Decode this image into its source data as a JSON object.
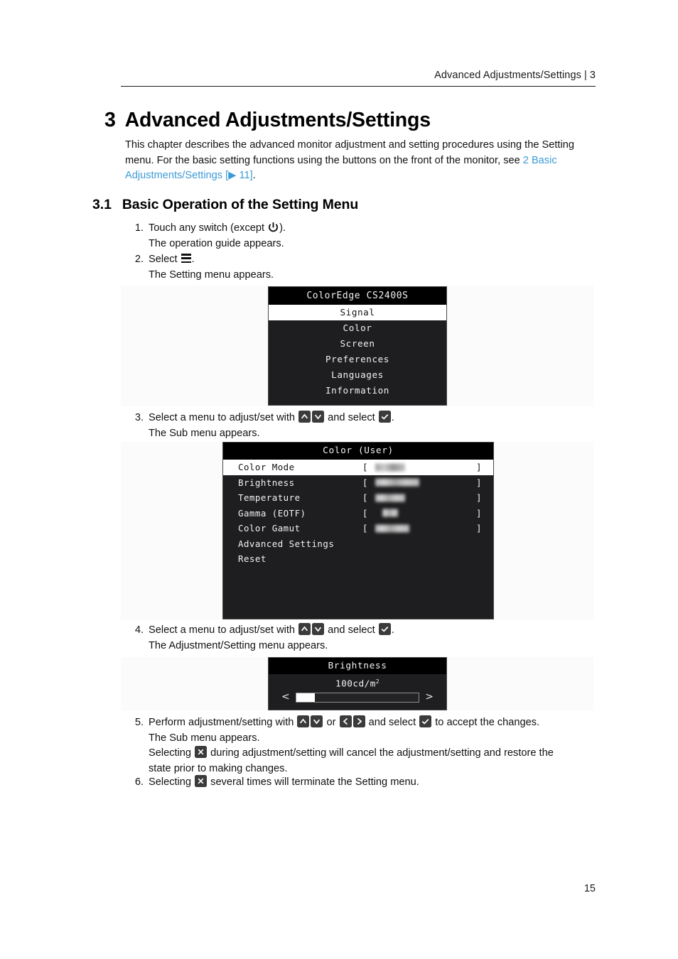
{
  "header": {
    "title": "Advanced Adjustments/Settings",
    "separator": "|",
    "chapter_number": "3"
  },
  "chapter": {
    "number": "3",
    "title": "Advanced Adjustments/Settings"
  },
  "intro": {
    "line1": "This chapter describes the advanced monitor adjustment and setting procedures using the",
    "line2": "Setting menu. For the basic setting functions using the buttons on the front of the monitor,",
    "line3_prefix": "see ",
    "link_text": "2 Basic Adjustments/Settings [",
    "link_arrow": "▶",
    "link_page": " 11]",
    "line3_suffix": "."
  },
  "section": {
    "number": "3.1",
    "title": "Basic Operation of the Setting Menu"
  },
  "steps": {
    "s1": {
      "marker": "1.",
      "text_a": "Touch any switch (except ",
      "text_b": ").",
      "sub": "The operation guide appears."
    },
    "s2": {
      "marker": "2.",
      "text_a": "Select ",
      "text_b": ".",
      "sub": "The Setting menu appears."
    },
    "s3": {
      "marker": "3.",
      "text_a": "Select a menu to adjust/set with ",
      "text_b": " and select ",
      "text_c": ".",
      "sub": "The Sub menu appears."
    },
    "s4": {
      "marker": "4.",
      "text_a": "Select a menu to adjust/set with ",
      "text_b": " and select ",
      "text_c": ".",
      "sub": "The Adjustment/Setting menu appears."
    },
    "s5": {
      "marker": "5.",
      "text_a": "Perform adjustment/setting with ",
      "text_b": " or ",
      "text_c": " and select ",
      "text_d": " to accept the changes.",
      "sub1": "The Sub menu appears.",
      "sub2_a": "Selecting ",
      "sub2_b": " during adjustment/setting will cancel the adjustment/setting and restore the",
      "sub3": "state prior to making changes."
    },
    "s6": {
      "marker": "6.",
      "text_a": "Selecting ",
      "text_b": " several times will terminate the Setting menu."
    }
  },
  "osd_main_menu": {
    "title": "ColorEdge CS2400S",
    "items": [
      {
        "label": "Signal",
        "selected": true
      },
      {
        "label": "Color",
        "selected": false
      },
      {
        "label": "Screen",
        "selected": false
      },
      {
        "label": "Preferences",
        "selected": false
      },
      {
        "label": "Languages",
        "selected": false
      },
      {
        "label": "Information",
        "selected": false
      }
    ]
  },
  "osd_sub_menu": {
    "title": "Color (User)",
    "bracket_open": "[",
    "bracket_close": "]",
    "items": [
      {
        "label": "Color Mode",
        "has_value": true,
        "value_masked": true,
        "value_width": 42,
        "selected": true
      },
      {
        "label": "Brightness",
        "has_value": true,
        "value_masked": true,
        "value_width": 62,
        "selected": false
      },
      {
        "label": "Temperature",
        "has_value": true,
        "value_masked": true,
        "value_width": 42,
        "selected": false
      },
      {
        "label": "Gamma (EOTF)",
        "has_value": true,
        "value_masked": true,
        "value_width": 22,
        "selected": false
      },
      {
        "label": "Color Gamut",
        "has_value": true,
        "value_masked": true,
        "value_width": 48,
        "selected": false
      },
      {
        "label": "Advanced Settings",
        "has_value": false,
        "selected": false
      },
      {
        "label": "Reset",
        "has_value": false,
        "selected": false
      }
    ]
  },
  "osd_brightness_dialog": {
    "title": "Brightness",
    "value": "100cd/m",
    "value_superscript": "2",
    "left_arrow": "<",
    "right_arrow": ">",
    "fill_percent": 15
  },
  "folio": {
    "page_number": "15"
  },
  "colors": {
    "link": "#3c9bd6",
    "osd_background": "#1e1e20",
    "osd_title_background": "#000000",
    "osd_text": "#f2f2f2",
    "osd_selected_background": "#ffffff",
    "key_icon_background": "#3b3b3b",
    "figure_band": "#fbfbfb"
  }
}
